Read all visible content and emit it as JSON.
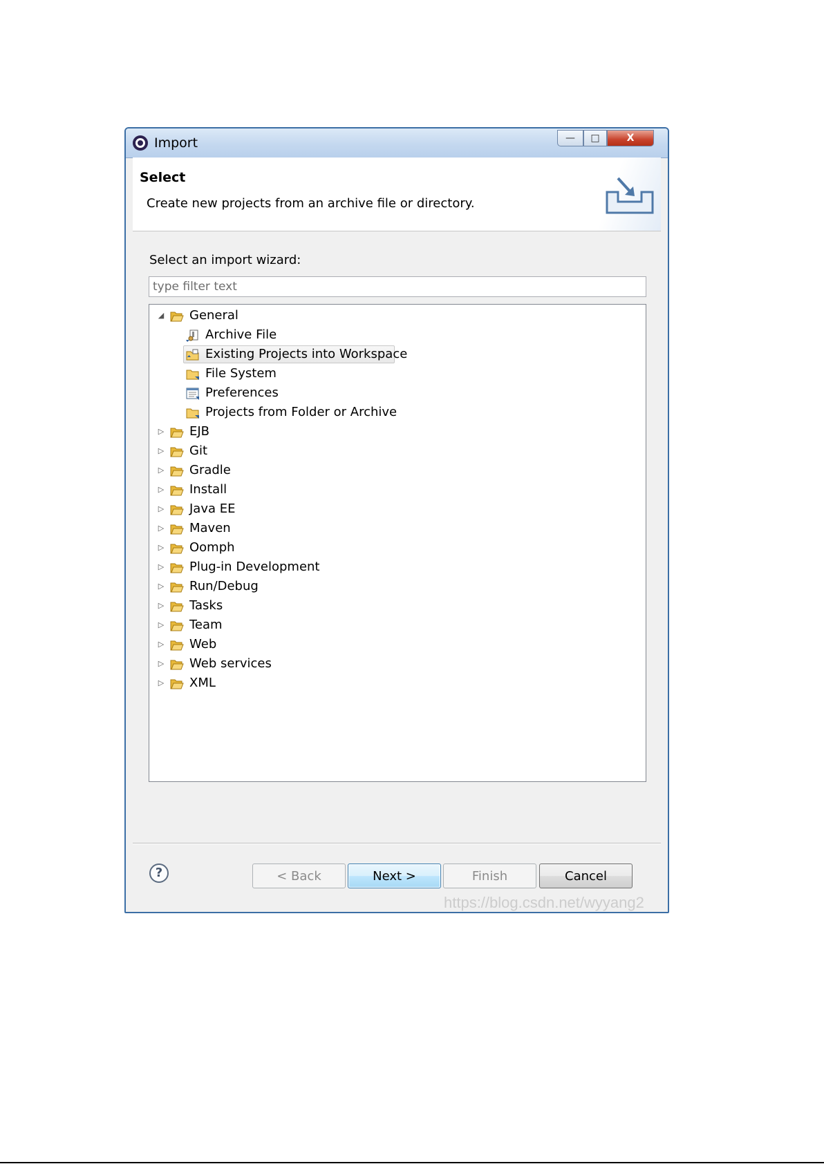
{
  "window": {
    "title": "Import",
    "min_glyph": "—",
    "max_glyph": "□",
    "close_glyph": "X"
  },
  "banner": {
    "title": "Select",
    "description": "Create new projects from an archive file or directory."
  },
  "wizard": {
    "label": "Select an import wizard:",
    "filter_placeholder": "type filter text"
  },
  "tree": {
    "general": {
      "label": "General",
      "children": [
        {
          "label": "Archive File",
          "icon": "archive-file-icon"
        },
        {
          "label": "Existing Projects into Workspace",
          "icon": "existing-projects-icon",
          "selected": true
        },
        {
          "label": "File System",
          "icon": "folder-import-icon"
        },
        {
          "label": "Preferences",
          "icon": "preferences-icon"
        },
        {
          "label": "Projects from Folder or Archive",
          "icon": "folder-import-icon"
        }
      ]
    },
    "categories": [
      "EJB",
      "Git",
      "Gradle",
      "Install",
      "Java EE",
      "Maven",
      "Oomph",
      "Plug-in Development",
      "Run/Debug",
      "Tasks",
      "Team",
      "Web",
      "Web services",
      "XML"
    ]
  },
  "buttons": {
    "help": "?",
    "back": "< Back",
    "next": "Next >",
    "finish": "Finish",
    "cancel": "Cancel"
  },
  "watermark": "https://blog.csdn.net/wyyang2",
  "colors": {
    "titlebar": "#c4d8ef",
    "folder": "#f3c553",
    "selection": "#e8e8e8"
  }
}
